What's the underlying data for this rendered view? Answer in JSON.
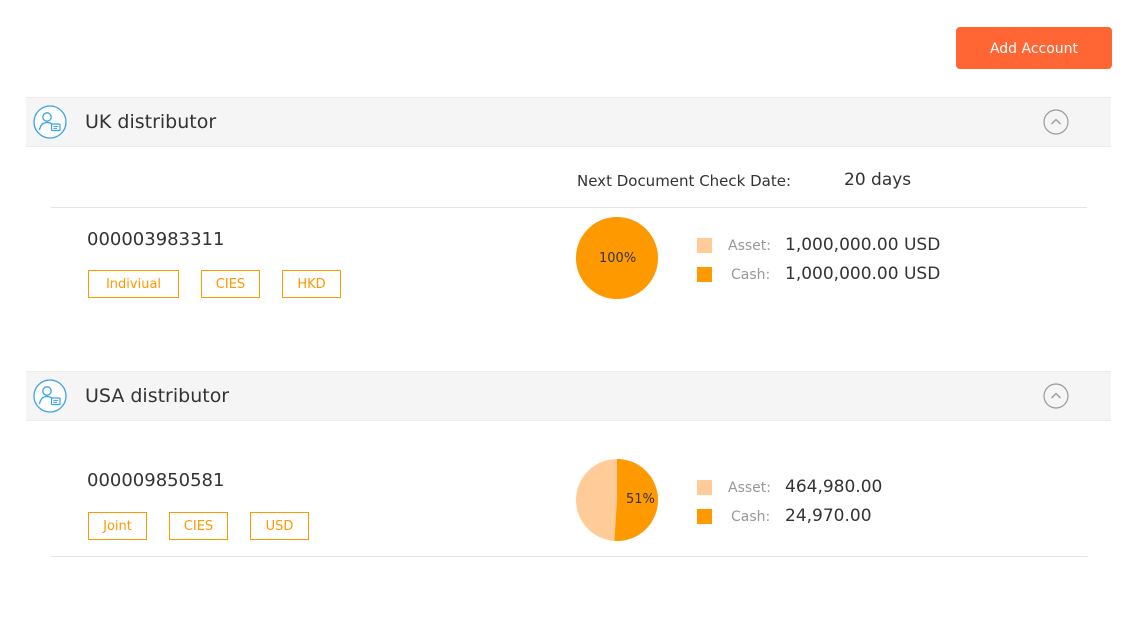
{
  "toolbar": {
    "add_account_label": "Add Account"
  },
  "colors": {
    "accent_button": "#ff6633",
    "tag_orange": "#ff9900",
    "cash_orange": "#ff9900",
    "asset_peach": "#ffcc99",
    "icon_blue": "#3aa3e3"
  },
  "groups": [
    {
      "title": "UK distributor",
      "icon": "user-card-icon",
      "collapse_icon": "chevron-up-icon",
      "next_check": {
        "label": "Next Document Check Date:",
        "value": "20 days"
      },
      "account": {
        "number": "000003983311",
        "tags": [
          "Indiviual",
          "CIES",
          "HKD"
        ],
        "pie": {
          "label": "100%",
          "cash_percent": 100
        },
        "legend": [
          {
            "label": "Asset:",
            "value": "1,000,000.00 USD"
          },
          {
            "label": "Cash:",
            "value": "1,000,000.00 USD"
          }
        ]
      }
    },
    {
      "title": "USA distributor",
      "icon": "user-card-icon",
      "collapse_icon": "chevron-up-icon",
      "account": {
        "number": "000009850581",
        "tags": [
          "Joint",
          "CIES",
          "USD"
        ],
        "pie": {
          "label": "51%",
          "cash_percent": 51
        },
        "legend": [
          {
            "label": "Asset:",
            "value": "464,980.00"
          },
          {
            "label": "Cash:",
            "value": "24,970.00"
          }
        ]
      }
    }
  ]
}
